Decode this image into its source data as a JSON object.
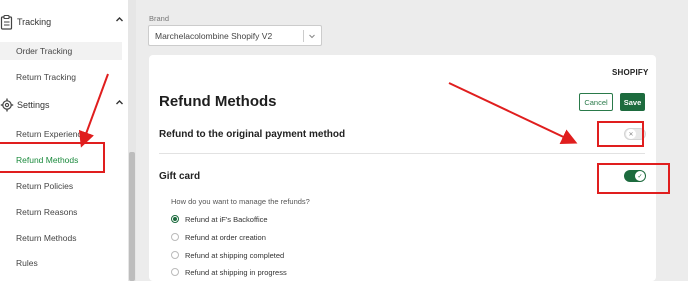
{
  "sidebar": {
    "tracking": {
      "label": "Tracking",
      "icon": "clipboard-icon"
    },
    "settings": {
      "label": "Settings",
      "icon": "gear-icon"
    },
    "tracking_items": [
      {
        "label": "Order Tracking"
      },
      {
        "label": "Return Tracking"
      }
    ],
    "settings_items": [
      {
        "label": "Return Experience"
      },
      {
        "label": "Refund Methods"
      },
      {
        "label": "Return Policies"
      },
      {
        "label": "Return Reasons"
      },
      {
        "label": "Return Methods"
      },
      {
        "label": "Rules"
      }
    ]
  },
  "brand": {
    "label": "Brand",
    "value": "Marchelacolombine Shopify V2"
  },
  "card": {
    "platform": "SHOPIFY",
    "title": "Refund Methods",
    "cancel_label": "Cancel",
    "save_label": "Save",
    "original_payment": {
      "label": "Refund to the original payment method",
      "enabled": false
    },
    "gift_card": {
      "label": "Gift card",
      "enabled": true
    },
    "question": "How do you want to manage the refunds?",
    "options": [
      {
        "label": "Refund at iF's Backoffice",
        "checked": true
      },
      {
        "label": "Refund at order creation",
        "checked": false
      },
      {
        "label": "Refund at shipping completed",
        "checked": false
      },
      {
        "label": "Refund at shipping in progress",
        "checked": false
      }
    ]
  },
  "colors": {
    "accent": "#1d6b3e",
    "active_nav": "#1a8a3c",
    "annotation": "#e01e1e"
  }
}
